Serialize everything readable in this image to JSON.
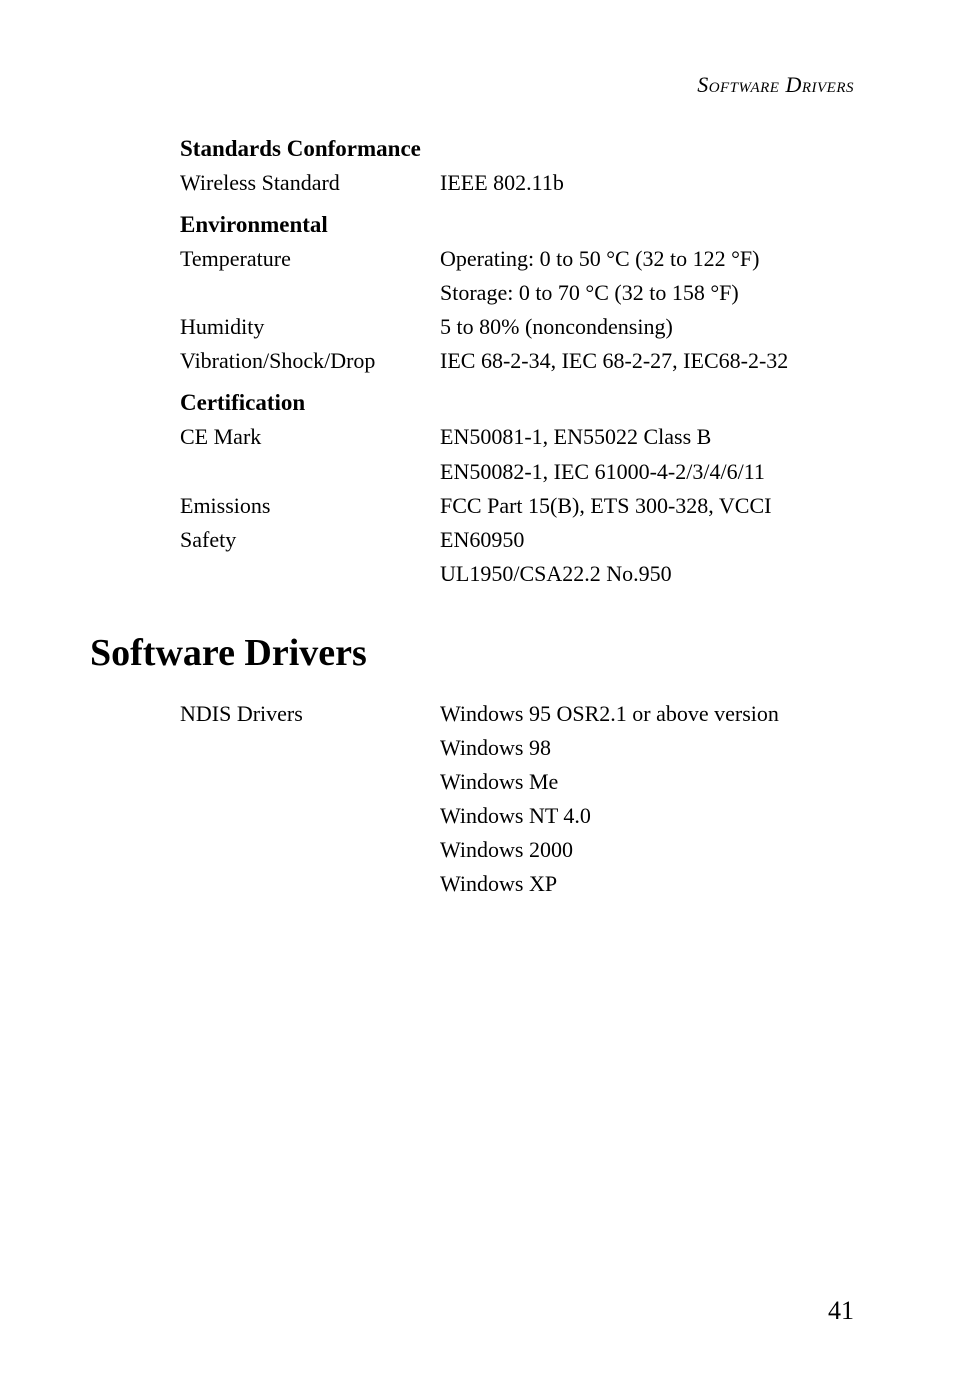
{
  "pageHeader": "Software Drivers",
  "sections": [
    {
      "heading": "Standards Conformance",
      "rows": [
        {
          "label": "Wireless Standard",
          "value": "IEEE 802.11b"
        }
      ]
    },
    {
      "heading": "Environmental",
      "rows": [
        {
          "label": "Temperature",
          "value": "Operating: 0 to 50 °C (32 to 122 °F)"
        },
        {
          "label": "",
          "value": "Storage: 0 to 70 °C (32 to 158 °F)"
        },
        {
          "label": "Humidity",
          "value": "5 to 80% (noncondensing)"
        },
        {
          "label": "Vibration/Shock/Drop",
          "value": "IEC 68-2-34, IEC 68-2-27, IEC68-2-32"
        }
      ]
    },
    {
      "heading": "Certification",
      "rows": [
        {
          "label": "CE Mark",
          "value": "EN50081-1, EN55022 Class B"
        },
        {
          "label": "",
          "value": "EN50082-1, IEC  61000-4-2/3/4/6/11"
        },
        {
          "label": "Emissions",
          "value": "FCC Part 15(B), ETS 300-328, VCCI"
        },
        {
          "label": "Safety",
          "value": "EN60950"
        },
        {
          "label": "",
          "value": "UL1950/CSA22.2 No.950"
        }
      ]
    }
  ],
  "mainHeading": "Software Drivers",
  "driverRows": [
    {
      "label": "NDIS Drivers",
      "value": "Windows 95 OSR2.1 or above version"
    },
    {
      "label": "",
      "value": "Windows 98"
    },
    {
      "label": "",
      "value": "Windows Me"
    },
    {
      "label": "",
      "value": "Windows NT 4.0"
    },
    {
      "label": "",
      "value": "Windows 2000"
    },
    {
      "label": "",
      "value": "Windows XP"
    }
  ],
  "pageNumber": "41"
}
